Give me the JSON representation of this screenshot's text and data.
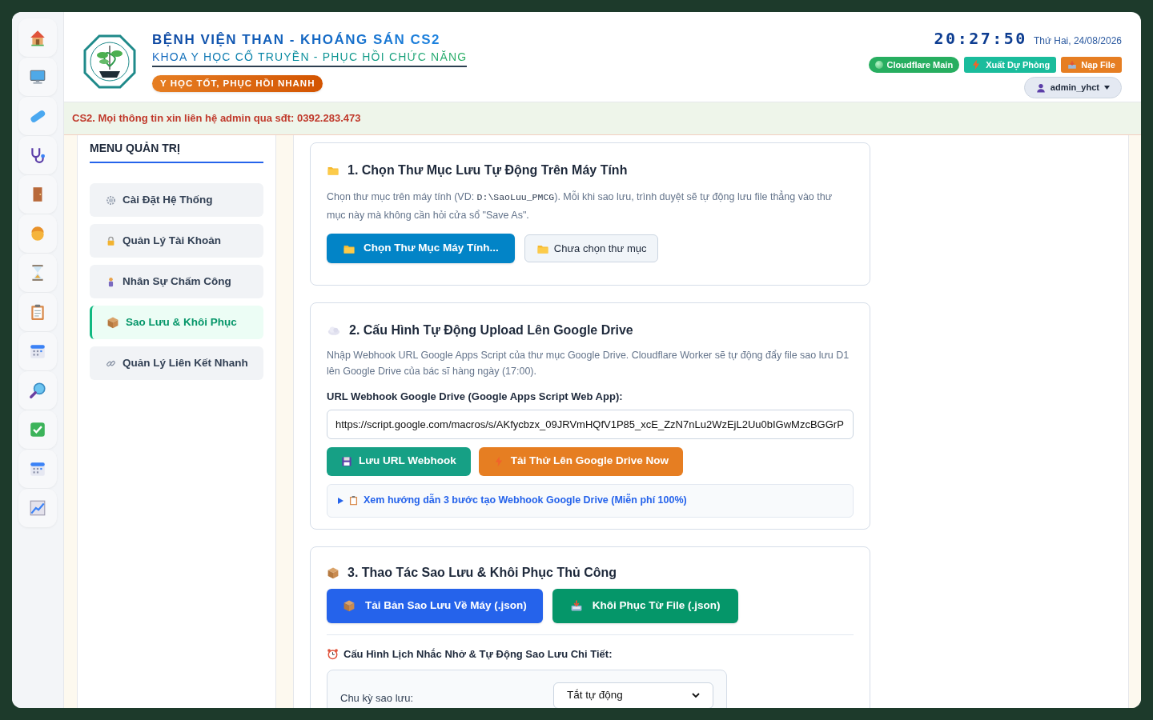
{
  "header": {
    "title": "BỆNH VIỆN THAN - KHOÁNG SÁN CS2",
    "subtitle": "KHOA Y HỌC CỔ TRUYỀN - PHỤC HỒI CHỨC NĂNG",
    "slogan": "Y HỌC TỐT, PHỤC HỒI NHANH",
    "clock": "20:27:50",
    "date": "Thứ Hai, 24/08/2026",
    "status_buttons": [
      {
        "label": "Cloudflare Main",
        "kind": "server"
      },
      {
        "label": "Xuất Dự Phòng",
        "kind": "export"
      },
      {
        "label": "Nạp File",
        "kind": "import"
      }
    ],
    "user": "admin_yhct"
  },
  "notice": "CS2. Mọi thông tin xin liên hệ admin qua sđt: 0392.283.473",
  "menu": {
    "title": "MENU QUẢN TRỊ",
    "items": [
      {
        "label": "Cài Đặt Hệ Thống",
        "selected": false
      },
      {
        "label": "Quản Lý Tài Khoản",
        "selected": false
      },
      {
        "label": "Nhân Sự Chấm Công",
        "selected": false
      },
      {
        "label": "Sao Lưu & Khôi Phục",
        "selected": true
      },
      {
        "label": "Quản Lý Liên Kết Nhanh",
        "selected": false
      }
    ]
  },
  "folder_section": {
    "title": "1. Chọn Thư Mục Lưu Tự Động Trên Máy Tính",
    "desc_before": "Chọn thư mục trên máy tính (VD: ",
    "desc_code": "D:\\SaoLuu_PMCG",
    "desc_after": "). Mỗi khi sao lưu, trình duyệt sẽ tự động lưu file thẳng vào thư mục này mà không cần hỏi cửa sổ \"Save As\".",
    "button": "Chọn Thư Mục Máy Tính...",
    "folder_status": "Chưa chọn thư mục"
  },
  "drive_section": {
    "title": "2. Cấu Hình Tự Động Upload Lên Google Drive",
    "description": "Nhập Webhook URL Google Apps Script của thư mục Google Drive. Cloudflare Worker sẽ tự động đẩy file sao lưu D1 lên Google Drive của bác sĩ hàng ngày (17:00).",
    "field_label": "URL Webhook Google Drive (Google Apps Script Web App):",
    "url": "https://script.google.com/macros/s/AKfycbzx_09JRVmHQfV1P85_xcE_ZzN7nLu2WzEjL2Uu0bIGwMzcBGGrP",
    "save_button": "Lưu URL Webhook",
    "test_button": "Tải Thử Lên Google Drive Now",
    "guide": "Xem hướng dẫn 3 bước tạo Webhook Google Drive (Miễn phí 100%)",
    "guide_expanded": false
  },
  "manual_section": {
    "title": "3. Thao Tác Sao Lưu & Khôi Phục Thủ Công",
    "download_button": "Tải Bản Sao Lưu Về Máy (.json)",
    "restore_button": "Khôi Phục Từ File (.json)",
    "schedule_title": "Cấu Hình Lịch Nhắc Nhở & Tự Động Sao Lưu Chi Tiết:",
    "cycle_label": "Chu kỳ sao lưu:",
    "cycle_value": "Tắt tự động"
  }
}
